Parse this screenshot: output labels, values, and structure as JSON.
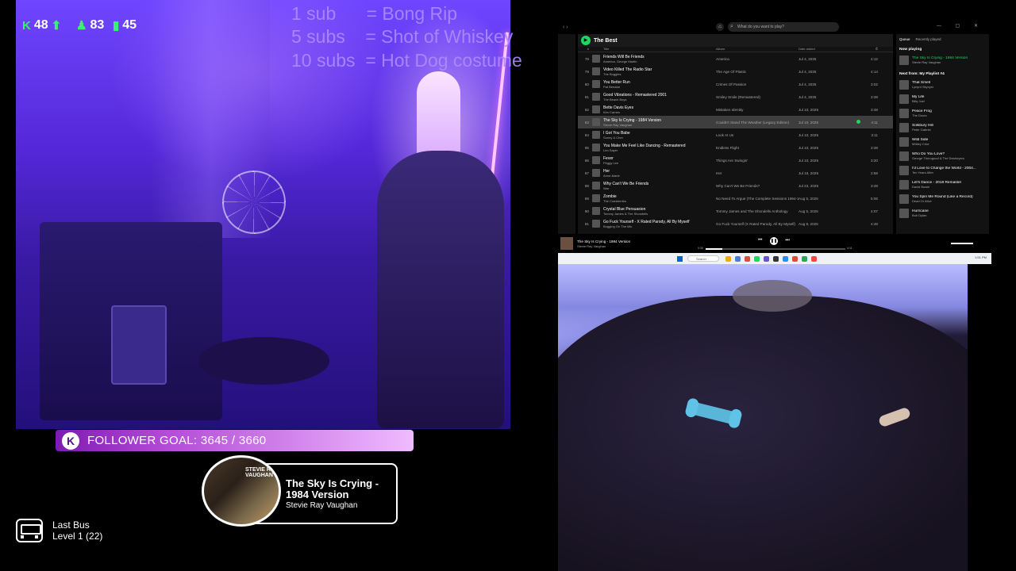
{
  "stream": {
    "stats": [
      {
        "icon": "kick-k-icon",
        "value": "48",
        "arrow": "⬆"
      },
      {
        "icon": "person-icon",
        "value": "83"
      },
      {
        "icon": "signal-bars-icon",
        "value": "45"
      }
    ],
    "sub_goals": [
      "1 sub      = Bong Rip",
      "5 subs    = Shot of Whiskey",
      "10 subs  = Hot Dog costume"
    ],
    "follower_goal": {
      "label": "FOLLOWER GOAL: 3645 / 3660",
      "current": 3645,
      "target": 3660
    },
    "now_playing": {
      "title": "The Sky Is Crying - 1984 Version",
      "artist": "Stevie Ray Vaughan",
      "cover_text": "STEVIE RAY VAUGHAN"
    },
    "last_bus": {
      "title": "Last Bus",
      "level": "Level 1  (22)"
    }
  },
  "spotify": {
    "search_placeholder": "What do you want to play?",
    "playlist_title": "The Best",
    "columns": {
      "num": "#",
      "title": "Title",
      "album": "Album",
      "date": "Date added",
      "dur": "⏱"
    },
    "rows": [
      {
        "n": "78",
        "title": "Friends Will Be Friends",
        "artist": "America, George Martin",
        "album": "America",
        "date": "Jul 4, 2025",
        "dur": "4:12"
      },
      {
        "n": "79",
        "title": "Video Killed The Radio Star",
        "artist": "The Buggles",
        "album": "The Age Of Plastic",
        "date": "Jul 4, 2025",
        "dur": "4:14"
      },
      {
        "n": "80",
        "title": "You Better Run",
        "artist": "Pat Benatar",
        "album": "Crimes Of Passion",
        "date": "Jul 4, 2025",
        "dur": "3:02"
      },
      {
        "n": "81",
        "title": "Good Vibrations - Remastered 2001",
        "artist": "The Beach Boys",
        "album": "Smiley Smile (Remastered)",
        "date": "Jul 4, 2025",
        "dur": "3:39"
      },
      {
        "n": "82",
        "title": "Bette Davis Eyes",
        "artist": "Kim Carnes",
        "album": "Mistaken Identity",
        "date": "Jul 10, 2025",
        "dur": "3:48"
      },
      {
        "n": "83",
        "title": "The Sky Is Crying - 1984 Version",
        "artist": "Stevie Ray Vaughan",
        "album": "Couldn't Stand The Weather (Legacy Edition)",
        "date": "Jul 10, 2025",
        "dur": "4:11",
        "active": true
      },
      {
        "n": "84",
        "title": "I Got You Babe",
        "artist": "Sonny & Cher",
        "album": "Look At Us",
        "date": "Jul 10, 2025",
        "dur": "3:11"
      },
      {
        "n": "85",
        "title": "You Make Me Feel Like Dancing - Remastered",
        "artist": "Leo Sayer",
        "album": "Endless Flight",
        "date": "Jul 10, 2025",
        "dur": "3:39"
      },
      {
        "n": "86",
        "title": "Fever",
        "artist": "Peggy Lee",
        "album": "Things Are Swingin'",
        "date": "Jul 10, 2025",
        "dur": "3:20"
      },
      {
        "n": "87",
        "title": "Her",
        "artist": "Anne-Marie",
        "album": "Her",
        "date": "Jul 16, 2025",
        "dur": "2:58"
      },
      {
        "n": "88",
        "title": "Why Can't We Be Friends",
        "artist": "War",
        "album": "Why Can't We Be Friends?",
        "date": "Jul 23, 2025",
        "dur": "3:49"
      },
      {
        "n": "89",
        "title": "Zombie",
        "artist": "The Cranberries",
        "album": "No Need To Argue (The Complete Sessions 1994-1995)",
        "date": "Aug 5, 2025",
        "dur": "5:06"
      },
      {
        "n": "90",
        "title": "Crystal Blue Persuasion",
        "artist": "Tommy James & The Shondells",
        "album": "Tommy James and The Shondells Anthology",
        "date": "Aug 5, 2025",
        "dur": "4:07"
      },
      {
        "n": "91",
        "title": "Go Fuck Yourself - X Rated Parody, All By Myself",
        "artist": "Bogging On The Mic",
        "album": "Go Fuck Yourself (X Rated Parody, All By Myself)",
        "date": "Aug 8, 2025",
        "dur": "4:49"
      }
    ],
    "queue": {
      "tabs": [
        "Queue",
        "Recently played"
      ],
      "now_playing_label": "Now playing",
      "now": {
        "title": "The Sky Is Crying - 1984 Version",
        "artist": "Stevie Ray Vaughan"
      },
      "next_label": "Next from: My Playlist #4",
      "items": [
        {
          "title": "That Smell",
          "artist": "Lynyrd Skynyrd"
        },
        {
          "title": "My Life",
          "artist": "Billy Joel"
        },
        {
          "title": "Peace Frog",
          "artist": "The Doors"
        },
        {
          "title": "Solsbury Hill",
          "artist": "Peter Gabriel"
        },
        {
          "title": "Wild Side",
          "artist": "Mötley Crüe"
        },
        {
          "title": "Who Do You Love?",
          "artist": "George Thorogood & The Destroyers"
        },
        {
          "title": "I'd Love to Change the World - 2004...",
          "artist": "Ten Years After"
        },
        {
          "title": "Let's Dance - 2018 Remaster",
          "artist": "David Bowie"
        },
        {
          "title": "You Spin Me Round (Like a Record)",
          "artist": "Dead Or Alive"
        },
        {
          "title": "Hurricane",
          "artist": "Bob Dylan"
        }
      ]
    },
    "player": {
      "title": "The Sky Is Crying - 1984 Version",
      "artist": "Stevie Ray Vaughan",
      "elapsed": "0:30",
      "total": "4:11",
      "progress": 0.12
    }
  },
  "taskbar": {
    "search": "Search",
    "tray": "1:51 PM"
  }
}
